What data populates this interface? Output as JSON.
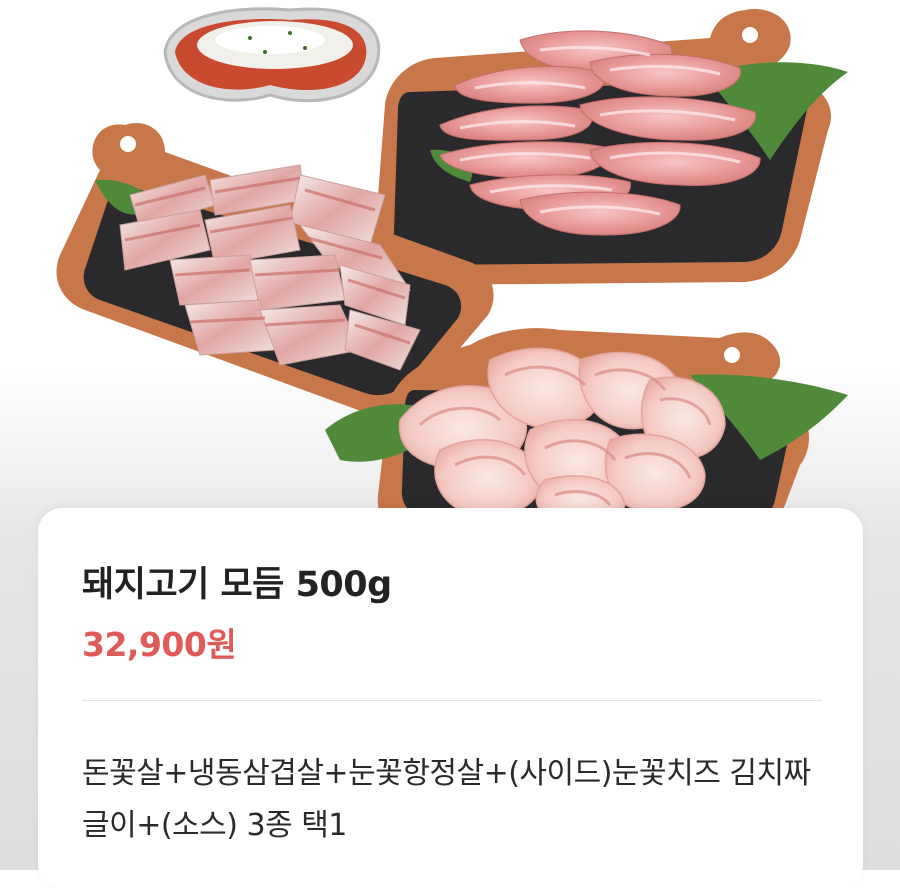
{
  "product": {
    "name": "돼지고기 모듬 500g",
    "price": "32,900원",
    "description": "돈꽃살+냉동삼겹살+눈꽃항정살+(사이드)눈꽃치즈 김치짜글이+(소스) 3종 택1"
  },
  "colors": {
    "price": "#e05a5a",
    "title": "#222222",
    "board": "#c8774a",
    "slate": "#2a2a2c",
    "leaf": "#4f8a3a"
  }
}
